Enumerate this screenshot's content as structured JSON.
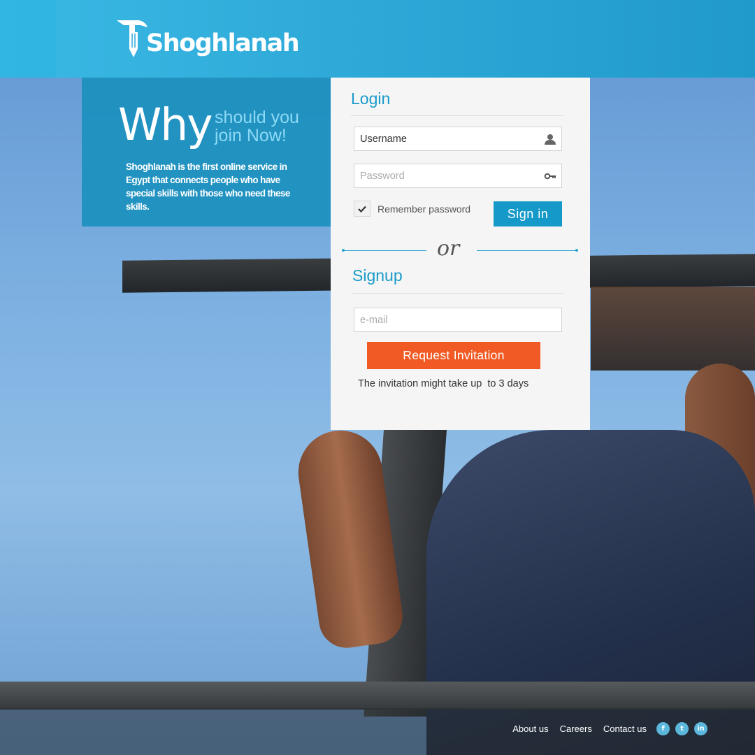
{
  "brand": {
    "name": "Shoghlanah",
    "accent": "#1a9bca",
    "header_color": "#2aaadb",
    "cta_color": "#f15a24"
  },
  "why": {
    "big": "Why",
    "small_line1": "should you",
    "small_line2": "join Now!",
    "description": "Shoghlanah is the first online service in Egypt that connects people who have special skills with those who need these skills."
  },
  "login": {
    "title": "Login",
    "username_value": "Username",
    "password_placeholder": "Password",
    "remember_label": "Remember password",
    "remember_checked": true,
    "signin_label": "Sign in",
    "icons": {
      "username": "user-icon",
      "password": "key-icon"
    }
  },
  "divider": {
    "text": "or"
  },
  "signup": {
    "title": "Signup",
    "email_placeholder": "e-mail",
    "request_label": "Request Invitation",
    "note": "The invitation might take up  to 3 days"
  },
  "footer": {
    "links": [
      "About us",
      "Careers",
      "Contact us"
    ],
    "social": [
      {
        "icon": "facebook-icon",
        "glyph": "f"
      },
      {
        "icon": "twitter-icon",
        "glyph": "t"
      },
      {
        "icon": "linkedin-icon",
        "glyph": "in"
      }
    ]
  }
}
